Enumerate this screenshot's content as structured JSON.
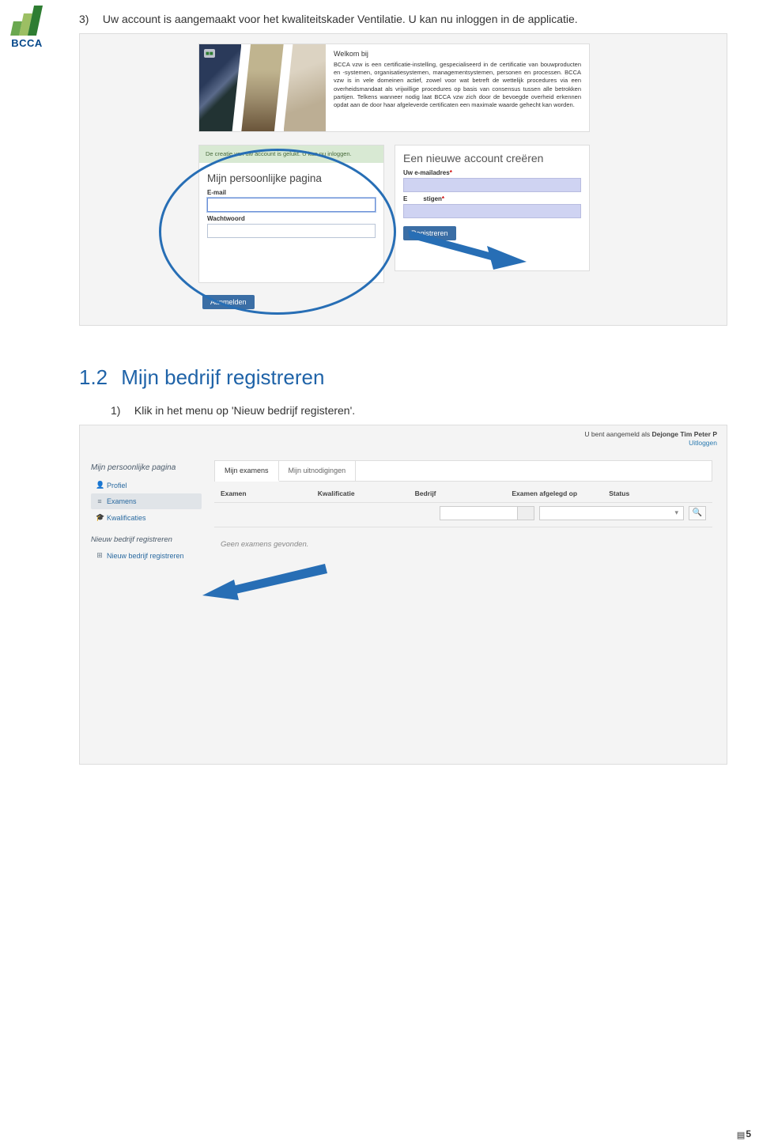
{
  "logo": {
    "text": "BCCA"
  },
  "intro": {
    "number": "3)",
    "text": "Uw account is aangemaakt voor het kwaliteitskader Ventilatie. U kan nu inloggen in de applicatie."
  },
  "screenshot1": {
    "welcome": {
      "title": "Welkom bij",
      "body": "BCCA vzw is een certificatie-instelling, gespecialiseerd in de certificatie van bouwproducten en -systemen, organisatiesystemen, managementsystemen, personen en processen. BCCA vzw is in vele domeinen actief, zowel voor wat betreft de wettelijk procedures via een overheidsmandaat als vrijwillige procedures op basis van consensus tussen alle betrokken partijen. Telkens wanneer nodig laat BCCA vzw zich door de bevoegde overheid erkennen opdat aan de door haar afgeleverde certificaten een maximale waarde gehecht kan worden."
    },
    "login": {
      "success": "De creatie van uw account is gelukt. U kan nu inloggen.",
      "heading": "Mijn persoonlijke pagina",
      "email_label": "E-mail",
      "password_label": "Wachtwoord",
      "submit": "Aanmelden"
    },
    "register": {
      "heading": "Een nieuwe account creëren",
      "email_label": "Uw e-mailadres",
      "confirm_label_prefix": "E",
      "confirm_label_suffix": "stigen",
      "submit": "Registreren"
    }
  },
  "section": {
    "number": "1.2",
    "title": "Mijn bedrijf registreren",
    "step": {
      "number": "1)",
      "text": "Klik in het menu op 'Nieuw bedrijf registeren'."
    }
  },
  "screenshot2": {
    "topbar": {
      "loggedin_prefix": "U bent aangemeld als ",
      "username": "Dejonge Tim Peter P",
      "logout": "Uitloggen"
    },
    "sidebar": {
      "title": "Mijn persoonlijke pagina",
      "items": [
        {
          "icon": "👤",
          "label": "Profiel"
        },
        {
          "icon": "≡",
          "label": "Examens"
        },
        {
          "icon": "🎓",
          "label": "Kwalificaties"
        }
      ],
      "group_title": "Nieuw bedrijf registreren",
      "group_item": {
        "icon": "⊞",
        "label": "Nieuw bedrijf registreren"
      }
    },
    "tabs": [
      {
        "label": "Mijn examens",
        "active": true
      },
      {
        "label": "Mijn uitnodigingen",
        "active": false
      }
    ],
    "columns": [
      "Examen",
      "Kwalificatie",
      "Bedrijf",
      "Examen afgelegd op",
      "Status"
    ],
    "empty": "Geen examens gevonden."
  },
  "page_number": "5"
}
